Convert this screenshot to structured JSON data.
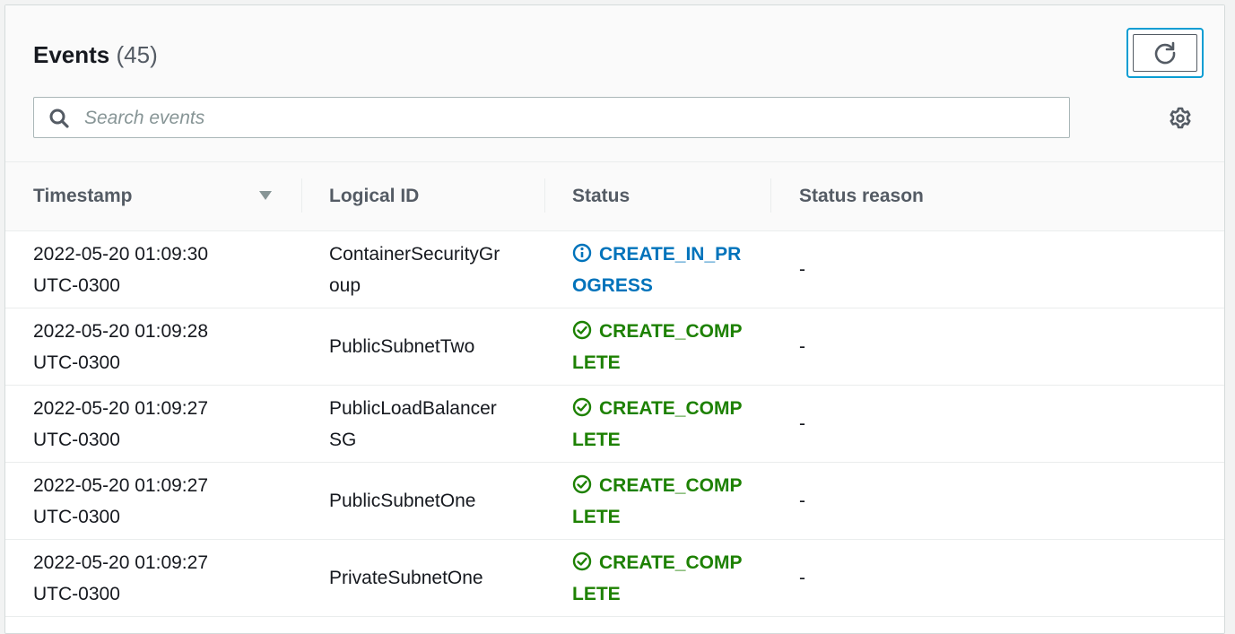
{
  "header": {
    "title": "Events",
    "count": "(45)",
    "search_placeholder": "Search events"
  },
  "columns": {
    "timestamp": "Timestamp",
    "logical_id": "Logical ID",
    "status": "Status",
    "status_reason": "Status reason"
  },
  "colors": {
    "in_progress": "#0073bb",
    "complete": "#1d8102",
    "focus_ring": "#0a9dd3"
  },
  "rows": [
    {
      "ts1": "2022-05-20 01:09:30",
      "ts2": "UTC-0300",
      "id1": "ContainerSecurityGr",
      "id2": "oup",
      "st1": "CREATE_IN_PR",
      "st2": "OGRESS",
      "reason": "-",
      "status_type": "in-progress"
    },
    {
      "ts1": "2022-05-20 01:09:28",
      "ts2": "UTC-0300",
      "id1": "PublicSubnetTwo",
      "id2": "",
      "st1": "CREATE_COMP",
      "st2": "LETE",
      "reason": "-",
      "status_type": "complete"
    },
    {
      "ts1": "2022-05-20 01:09:27",
      "ts2": "UTC-0300",
      "id1": "PublicLoadBalancer",
      "id2": "SG",
      "st1": "CREATE_COMP",
      "st2": "LETE",
      "reason": "-",
      "status_type": "complete"
    },
    {
      "ts1": "2022-05-20 01:09:27",
      "ts2": "UTC-0300",
      "id1": "PublicSubnetOne",
      "id2": "",
      "st1": "CREATE_COMP",
      "st2": "LETE",
      "reason": "-",
      "status_type": "complete"
    },
    {
      "ts1": "2022-05-20 01:09:27",
      "ts2": "UTC-0300",
      "id1": "PrivateSubnetOne",
      "id2": "",
      "st1": "CREATE_COMP",
      "st2": "LETE",
      "reason": "-",
      "status_type": "complete"
    }
  ]
}
